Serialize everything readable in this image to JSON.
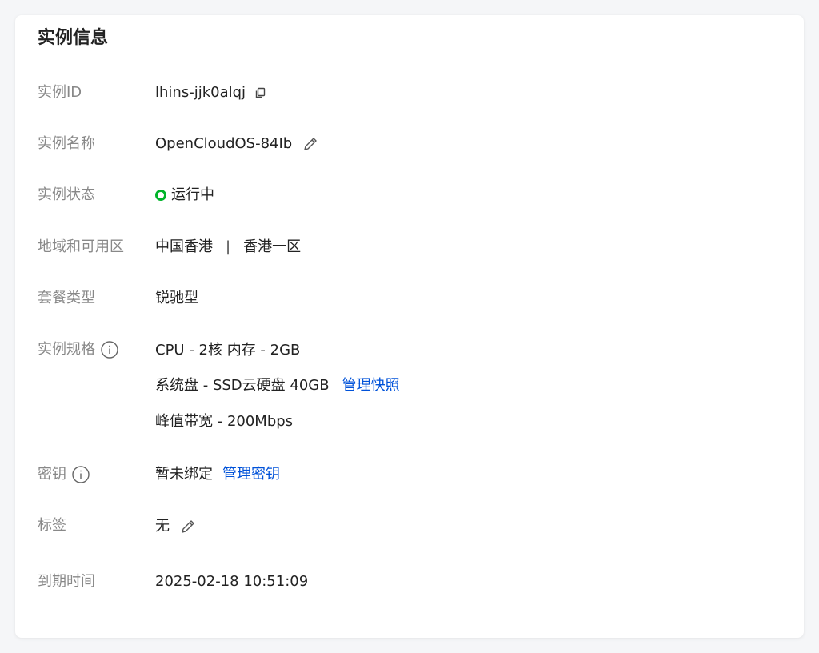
{
  "title": "实例信息",
  "fields": {
    "instance_id": {
      "label": "实例ID",
      "value": "lhins-jjk0alqj",
      "icon": "copy-icon"
    },
    "instance_name": {
      "label": "实例名称",
      "value": "OpenCloudOS-84Ib",
      "icon": "edit-icon"
    },
    "instance_status": {
      "label": "实例状态",
      "value": "运行中",
      "status_color": "#00b42a"
    },
    "region": {
      "label": "地域和可用区",
      "region": "中国香港",
      "separator": "|",
      "zone": "香港一区"
    },
    "package_type": {
      "label": "套餐类型",
      "value": "锐驰型"
    },
    "instance_spec": {
      "label": "实例规格",
      "icon": "info-icon",
      "cpu_memory": "CPU - 2核 内存 - 2GB",
      "system_disk": "系统盘 - SSD云硬盘 40GB",
      "snapshot_link": "管理快照",
      "bandwidth": "峰值带宽 - 200Mbps"
    },
    "key": {
      "label": "密钥",
      "icon": "info-icon",
      "value": "暂未绑定",
      "manage_link": "管理密钥"
    },
    "tags": {
      "label": "标签",
      "value": "无",
      "icon": "edit-icon"
    },
    "expiry": {
      "label": "到期时间",
      "value": "2025-02-18 10:51:09"
    }
  },
  "colors": {
    "link": "#0052d9",
    "label": "#888888",
    "text": "#222222",
    "status_running": "#00b42a"
  }
}
